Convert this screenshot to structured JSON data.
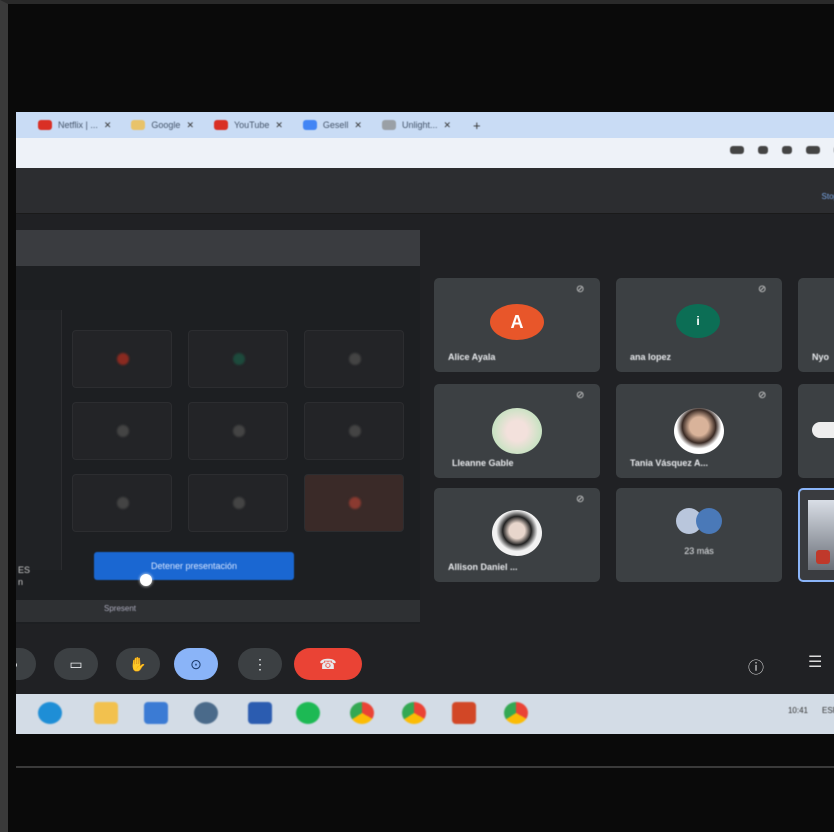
{
  "browser": {
    "tabs": [
      {
        "label": "Netflix | ...",
        "color": "#d93025"
      },
      {
        "label": "Google",
        "color": "#e8c36a"
      },
      {
        "label": "YouTube",
        "color": "#d93025"
      },
      {
        "label": "Gesell",
        "color": "#4285f4"
      },
      {
        "label": "Unlight...",
        "color": "#9aa0a6"
      }
    ],
    "new_tab": "+"
  },
  "meet": {
    "link_text": "Stop"
  },
  "presentation": {
    "stop_button": "Detener presentación",
    "bottom_label": "Spresent",
    "left_label_1": "ES",
    "left_label_2": "n"
  },
  "participants": [
    {
      "name": "Alice Ayala",
      "initial": "A",
      "avatar_color": "#e8562a",
      "kind": "initial"
    },
    {
      "name": "ana lopez",
      "initial": "i",
      "avatar_color": "#0c6e55",
      "kind": "initial"
    },
    {
      "name": "Nyo",
      "initial": "",
      "avatar_color": "",
      "kind": "partial"
    },
    {
      "name": "Lleanne Gable",
      "initial": "",
      "avatar_color": "#f0d6d0",
      "kind": "photo"
    },
    {
      "name": "Tania Vásquez A...",
      "initial": "",
      "avatar_color": "#c8b8a8",
      "kind": "photo"
    },
    {
      "name": "",
      "initial": "",
      "avatar_color": "",
      "kind": "partial"
    },
    {
      "name": "Allison Daniel ...",
      "initial": "",
      "avatar_color": "#ddd",
      "kind": "photo"
    },
    {
      "name": "23 más",
      "initial": "",
      "avatar_color": "#5a7ab0",
      "kind": "group"
    },
    {
      "name": "",
      "initial": "",
      "avatar_color": "",
      "kind": "self"
    }
  ],
  "taskbar": {
    "apps": [
      "edge",
      "explorer",
      "store",
      "dell",
      "word",
      "spotify",
      "chrome",
      "chrome2",
      "powerpoint",
      "chrome3"
    ],
    "tray_time": "10:41",
    "tray_lang": "ESP"
  },
  "colors": {
    "end_call": "#ea4335",
    "present_active": "#8ab4f8",
    "stop_button": "#1a67d2"
  }
}
